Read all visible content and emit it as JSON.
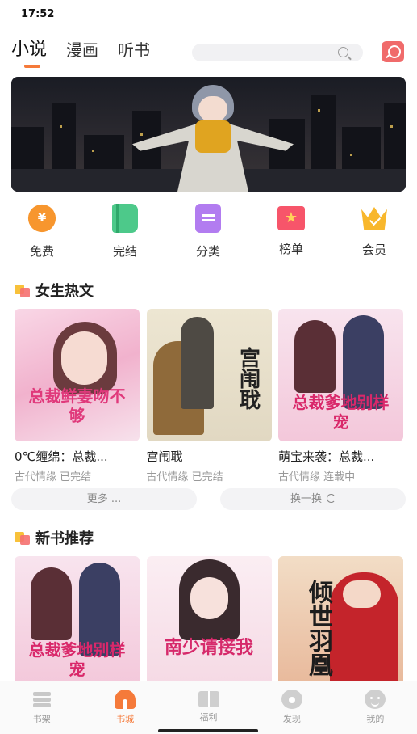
{
  "status": {
    "time": "17:52"
  },
  "top_tabs": [
    {
      "label": "小说",
      "active": true
    },
    {
      "label": "漫画",
      "active": false
    },
    {
      "label": "听书",
      "active": false
    }
  ],
  "quick_entries": [
    {
      "label": "免费",
      "icon": "coin-yen-icon"
    },
    {
      "label": "完结",
      "icon": "book-icon"
    },
    {
      "label": "分类",
      "icon": "document-list-icon"
    },
    {
      "label": "榜单",
      "icon": "ranking-star-icon"
    },
    {
      "label": "会员",
      "icon": "crown-icon"
    }
  ],
  "female_hot": {
    "title": "女生热文",
    "books": [
      {
        "name": "0℃缠绵：总裁...",
        "meta": "古代情缘 已完结",
        "cover_text": "总裁鲜妻吻不够"
      },
      {
        "name": "宫闱聀",
        "meta": "古代情缘 已完结",
        "cover_text": "宫闱聀"
      },
      {
        "name": "萌宝来袭：总裁...",
        "meta": "古代情缘 连载中",
        "cover_text": "总裁爹地别样宠"
      }
    ],
    "more_label": "更多 ...",
    "refresh_label": "换一换"
  },
  "new_books": {
    "title": "新书推荐",
    "books": [
      {
        "cover_text": "总裁爹地别样宠"
      },
      {
        "cover_text": "南少请接我"
      },
      {
        "cover_text": "倾世羽凰"
      }
    ]
  },
  "tabbar": [
    {
      "label": "书架",
      "active": false
    },
    {
      "label": "书城",
      "active": true
    },
    {
      "label": "福利",
      "active": false
    },
    {
      "label": "发现",
      "active": false
    },
    {
      "label": "我的",
      "active": false
    }
  ],
  "colors": {
    "accent": "#f57a3a"
  }
}
